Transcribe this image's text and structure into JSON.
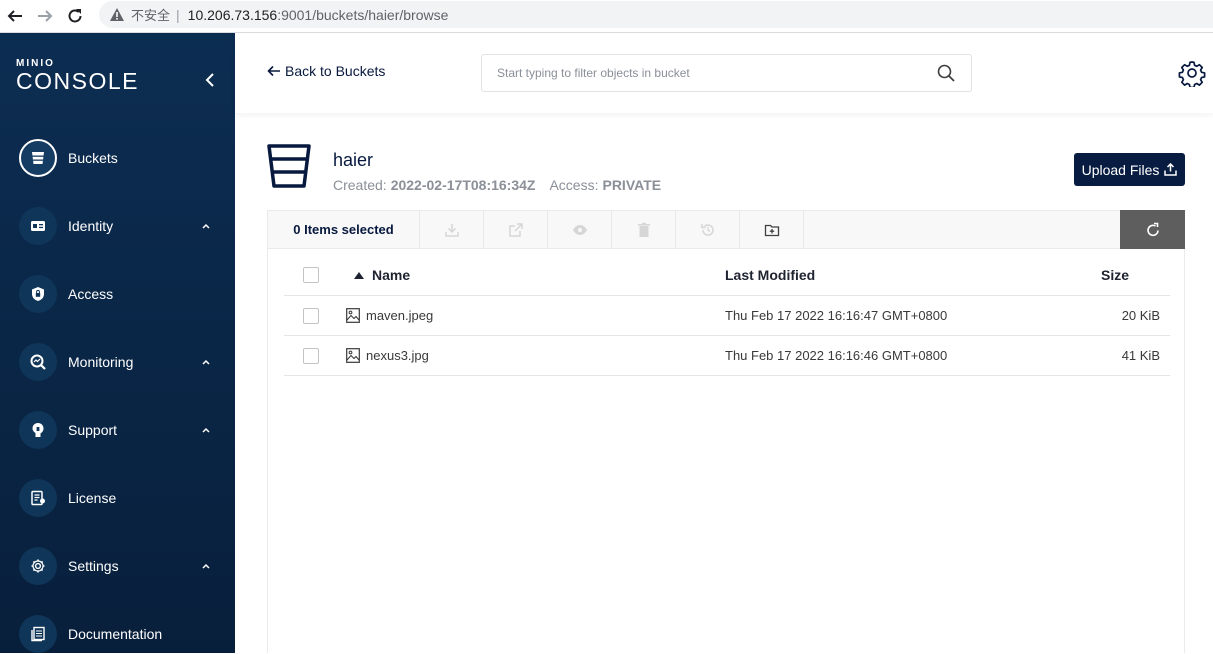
{
  "browser": {
    "insecure_label": "不安全",
    "separator": "|",
    "url_host": "10.206.73.156",
    "url_path": ":9001/buckets/haier/browse"
  },
  "logo": {
    "top": "MINIO",
    "bottom": "CONSOLE"
  },
  "sidebar": {
    "items": [
      {
        "label": "Buckets",
        "icon": "bucket-icon",
        "active": true,
        "expandable": false
      },
      {
        "label": "Identity",
        "icon": "identity-card-icon",
        "active": false,
        "expandable": true
      },
      {
        "label": "Access",
        "icon": "lock-icon",
        "active": false,
        "expandable": false
      },
      {
        "label": "Monitoring",
        "icon": "monitoring-icon",
        "active": false,
        "expandable": true
      },
      {
        "label": "Support",
        "icon": "support-icon",
        "active": false,
        "expandable": true
      },
      {
        "label": "License",
        "icon": "license-icon",
        "active": false,
        "expandable": false
      },
      {
        "label": "Settings",
        "icon": "gear-icon",
        "active": false,
        "expandable": true
      },
      {
        "label": "Documentation",
        "icon": "documentation-icon",
        "active": false,
        "expandable": false
      }
    ]
  },
  "header": {
    "back_label": "Back to Buckets",
    "search_placeholder": "Start typing to filter objects in bucket"
  },
  "bucket": {
    "name": "haier",
    "created_label": "Created:",
    "created_value": "2022-02-17T08:16:34Z",
    "access_label": "Access:",
    "access_value": "PRIVATE",
    "upload_label": "Upload Files"
  },
  "toolbar": {
    "selected_label": "0 Items selected",
    "buttons": [
      "download-icon",
      "share-icon",
      "preview-icon",
      "delete-icon",
      "rewind-icon",
      "new-folder-icon"
    ]
  },
  "table": {
    "columns": {
      "name": "Name",
      "modified": "Last Modified",
      "size": "Size"
    },
    "rows": [
      {
        "name": "maven.jpeg",
        "modified": "Thu Feb 17 2022 16:16:47 GMT+0800",
        "size": "20 KiB"
      },
      {
        "name": "nexus3.jpg",
        "modified": "Thu Feb 17 2022 16:16:46 GMT+0800",
        "size": "41 KiB"
      }
    ]
  },
  "colors": {
    "sidebar_bg": "#0c2d52",
    "primary": "#081c42",
    "refresh_bg": "#5e5e5e"
  }
}
